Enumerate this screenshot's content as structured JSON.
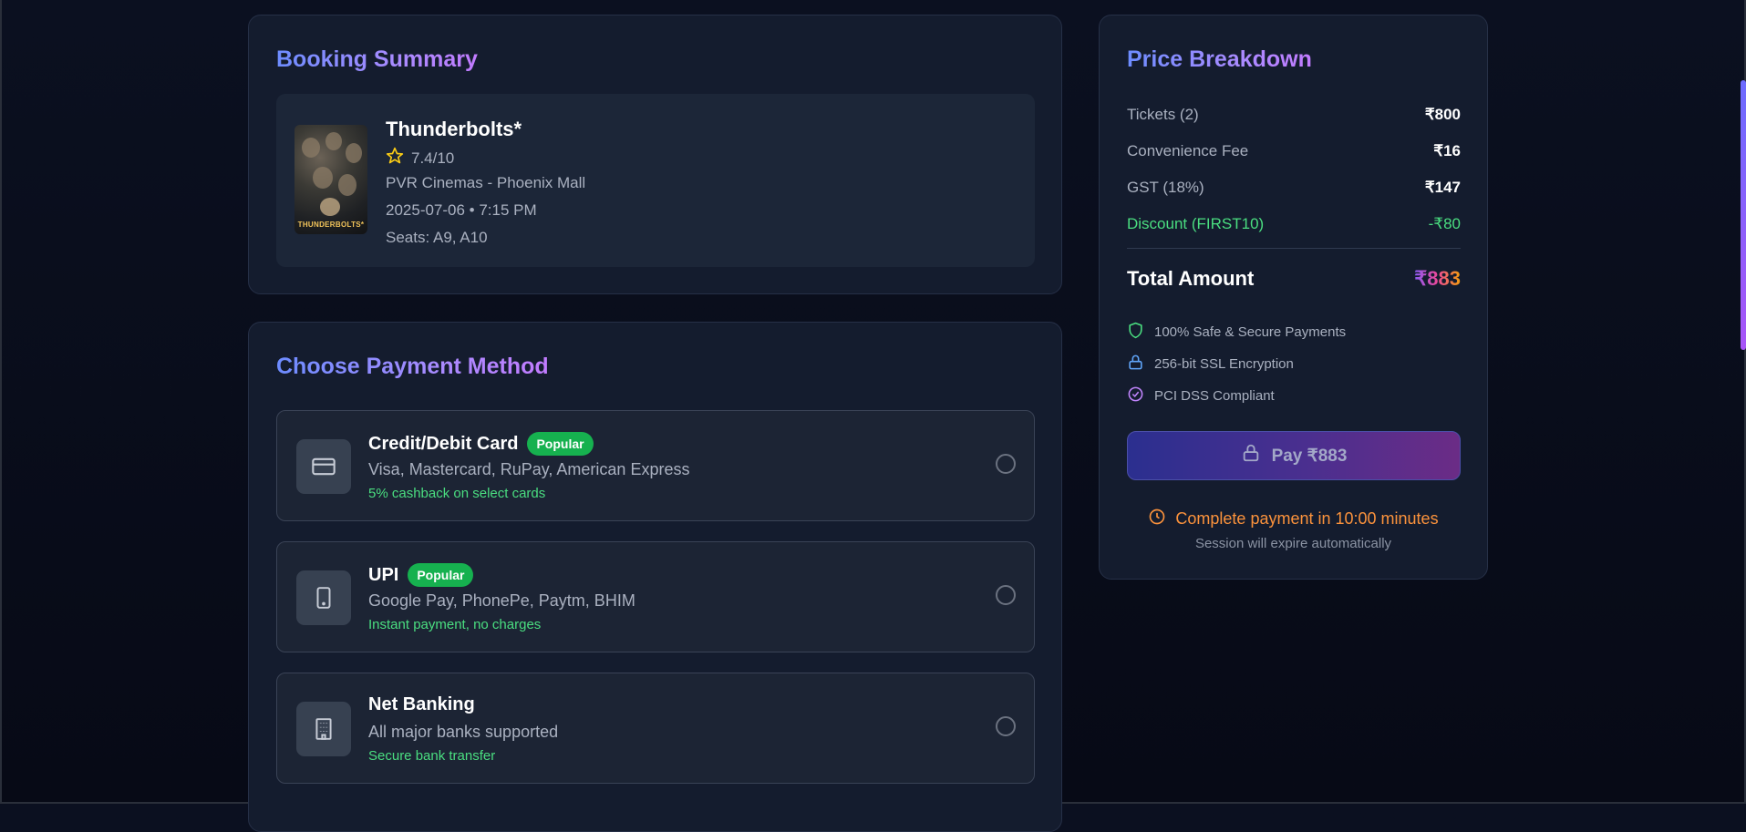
{
  "booking": {
    "title": "Booking Summary",
    "movie": {
      "poster_text": "THUNDERBOLTS*",
      "title": "Thunderbolts*",
      "rating": "7.4/10",
      "theater": "PVR Cinemas - Phoenix Mall",
      "datetime": "2025-07-06 • 7:15 PM",
      "seats": "Seats: A9, A10"
    }
  },
  "payment": {
    "title": "Choose Payment Method",
    "methods": [
      {
        "name": "Credit/Debit Card",
        "badge": "Popular",
        "desc": "Visa, Mastercard, RuPay, American Express",
        "note": "5% cashback on select cards",
        "icon": "credit-card-icon"
      },
      {
        "name": "UPI",
        "badge": "Popular",
        "desc": "Google Pay, PhonePe, Paytm, BHIM",
        "note": "Instant payment, no charges",
        "icon": "smartphone-icon"
      },
      {
        "name": "Net Banking",
        "badge": "",
        "desc": "All major banks supported",
        "note": "Secure bank transfer",
        "icon": "building-icon"
      }
    ]
  },
  "price": {
    "title": "Price Breakdown",
    "rows": [
      {
        "label": "Tickets (2)",
        "value": "₹800"
      },
      {
        "label": "Convenience Fee",
        "value": "₹16"
      },
      {
        "label": "GST (18%)",
        "value": "₹147"
      },
      {
        "label": "Discount (FIRST10)",
        "value": "-₹80"
      }
    ],
    "total_label": "Total Amount",
    "total_value": "₹883",
    "security": [
      {
        "text": "100% Safe & Secure Payments",
        "icon": "shield-icon"
      },
      {
        "text": "256-bit SSL Encryption",
        "icon": "lock-icon"
      },
      {
        "text": "PCI DSS Compliant",
        "icon": "check-circle-icon"
      }
    ],
    "pay_button": "Pay ₹883",
    "timer": "Complete payment in 10:00 minutes",
    "expire": "Session will expire automatically"
  },
  "colors": {
    "accent_green": "#4ade80",
    "badge_green": "#16b14f",
    "timer_orange": "#fb923c",
    "title_gradient_start": "#6d8cff",
    "title_gradient_end": "#c27bff"
  }
}
